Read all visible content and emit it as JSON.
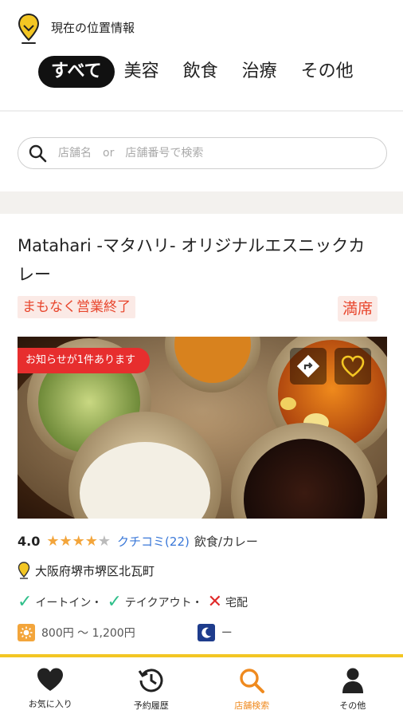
{
  "header": {
    "location_label": "現在の位置情報",
    "tabs": [
      {
        "label": "すべて",
        "active": true
      },
      {
        "label": "美容",
        "active": false
      },
      {
        "label": "飲食",
        "active": false
      },
      {
        "label": "治療",
        "active": false
      },
      {
        "label": "その他",
        "active": false
      }
    ]
  },
  "search": {
    "placeholder": "店舗名　or　店舗番号で検索"
  },
  "shop": {
    "name": "Matahari -マタハリ- オリジナルエスニックカレー",
    "status": "まもなく営業終了",
    "availability": "満席",
    "notice": "お知らせが1件あります",
    "rating": "4.0",
    "rating_value": 4,
    "rating_max": 5,
    "reviews": "クチコミ(22)",
    "genre": "飲食/カレー",
    "address": "大阪府堺市堺区北瓦町",
    "services": [
      {
        "label": "イートイン・",
        "available": true
      },
      {
        "label": "テイクアウト・",
        "available": true
      },
      {
        "label": "宅配",
        "available": false
      }
    ],
    "lunch_price": "800円 ～ 1,200円",
    "dinner_price": "ー"
  },
  "bottom_nav": [
    {
      "label": "お気に入り",
      "icon": "heart-icon",
      "active": false
    },
    {
      "label": "予約履歴",
      "icon": "history-icon",
      "active": false
    },
    {
      "label": "店舗検索",
      "icon": "search-icon",
      "active": true
    },
    {
      "label": "その他",
      "icon": "person-icon",
      "active": false
    }
  ],
  "colors": {
    "accent": "#f3c623",
    "active_nav": "#ef8a1f",
    "alert": "#e8452c",
    "link": "#3a78d8",
    "ok": "#2fbf8a"
  }
}
